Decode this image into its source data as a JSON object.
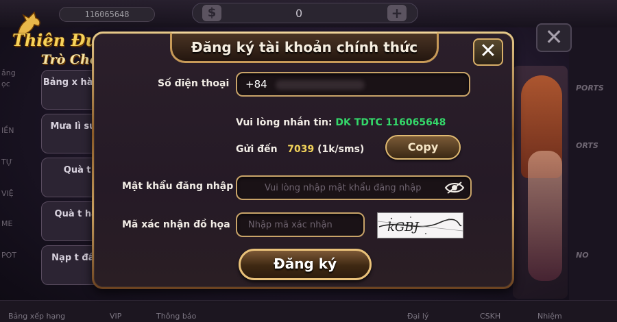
{
  "background": {
    "balance": "116065648",
    "slot_counter": "0",
    "sidebar_items": [
      "Bảng x hàng ng",
      "Mưa lì sứ già",
      "Quà t V",
      "Quà t hàng",
      "Nạp t đầu m"
    ],
    "left_strip": [
      "ảng",
      "ọc",
      "IỀN",
      "TỰ",
      "VIỆ",
      "ME",
      "POT"
    ],
    "right_strip": [
      "PORTS",
      "ORTS",
      "NO"
    ],
    "bottom_nav": [
      "Bảng xếp hạng",
      "VIP",
      "Thông báo",
      "Đại lý",
      "CSKH",
      "Nhiệm"
    ],
    "close_symbol": "✕"
  },
  "logo": {
    "line1": "Thiên Đường",
    "line2": "Trò Chơi"
  },
  "modal": {
    "title": "Đăng ký tài khoản chính thức",
    "close_symbol": "✕",
    "phone": {
      "label": "Số điện thoại",
      "value": "+84"
    },
    "sms": {
      "instruction_prefix": "Vui lòng nhắn tin:",
      "message_code": "DK TDTC 116065648",
      "send_to_prefix": "Gửi đến",
      "send_to_number": "7039",
      "price_note": "(1k/sms)"
    },
    "copy_button": "Copy",
    "password": {
      "label": "Mật khẩu đăng nhập",
      "placeholder": "Vui lòng nhập mật khẩu đăng nhập"
    },
    "captcha": {
      "label": "Mã xác nhận đồ họa",
      "placeholder": "Nhập mã xác nhận",
      "image_text": "kGBJ"
    },
    "register_button": "Đăng ký"
  },
  "colors": {
    "gold_border": "#c9a469",
    "sms_green": "#34d86a",
    "sms_gold": "#f2d35a",
    "modal_bg": "#2b1f2a"
  }
}
